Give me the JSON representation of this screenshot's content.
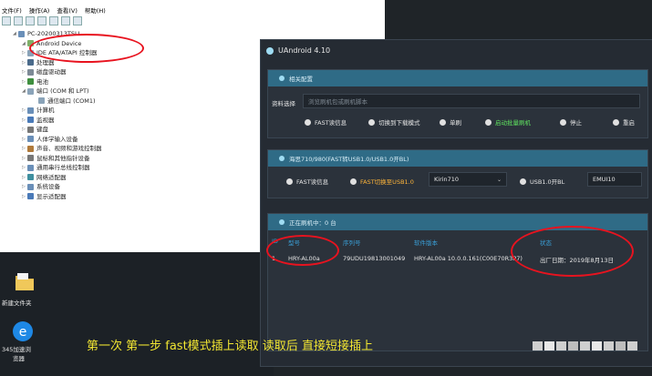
{
  "menu": [
    "文件(F)",
    "操作(A)",
    "查看(V)",
    "帮助(H)"
  ],
  "tree": [
    {
      "label": "PC-20200313TSLL",
      "expander": "◢",
      "indent": 0,
      "icon": "#6a8fb8"
    },
    {
      "label": "Android Device",
      "expander": "◢",
      "indent": 10,
      "icon": "#7fb069"
    },
    {
      "label": "IDE ATA/ATAPI 控制器",
      "expander": "▷",
      "indent": 10,
      "icon": "#8aa3b8"
    },
    {
      "label": "处理器",
      "expander": "▷",
      "indent": 10,
      "icon": "#4a6a8a"
    },
    {
      "label": "磁盘驱动器",
      "expander": "▷",
      "indent": 10,
      "icon": "#7d8a96"
    },
    {
      "label": "电池",
      "expander": "▷",
      "indent": 10,
      "icon": "#3f8f3f"
    },
    {
      "label": "端口 (COM 和 LPT)",
      "expander": "◢",
      "indent": 10,
      "icon": "#8aa3b8"
    },
    {
      "label": "通信端口 (COM1)",
      "expander": "",
      "indent": 22,
      "icon": "#8aa3b8"
    },
    {
      "label": "计算机",
      "expander": "▷",
      "indent": 10,
      "icon": "#6a8fb8"
    },
    {
      "label": "监视器",
      "expander": "▷",
      "indent": 10,
      "icon": "#4a7ab8"
    },
    {
      "label": "键盘",
      "expander": "▷",
      "indent": 10,
      "icon": "#777"
    },
    {
      "label": "人体学输入设备",
      "expander": "▷",
      "indent": 10,
      "icon": "#6a8fb8"
    },
    {
      "label": "声音、视频和游戏控制器",
      "expander": "▷",
      "indent": 10,
      "icon": "#b07a3a"
    },
    {
      "label": "鼠标和其他指针设备",
      "expander": "▷",
      "indent": 10,
      "icon": "#777"
    },
    {
      "label": "通用串行总线控制器",
      "expander": "▷",
      "indent": 10,
      "icon": "#6a8fb8"
    },
    {
      "label": "网络适配器",
      "expander": "▷",
      "indent": 10,
      "icon": "#3f8f9f"
    },
    {
      "label": "系统设备",
      "expander": "▷",
      "indent": 10,
      "icon": "#6a8fb8"
    },
    {
      "label": "显示适配器",
      "expander": "▷",
      "indent": 10,
      "icon": "#4a7ab8"
    }
  ],
  "desktop": {
    "folder_label": "新建文件夹",
    "browser_label": "345加速浏",
    "browser_label2": "览器"
  },
  "ua": {
    "title": "UAndroid 4.10",
    "panel1": {
      "head": "相关配置",
      "file_label": "资料选择",
      "file_placeholder": "浏览刷机包或刷机脚本",
      "buttons": [
        "FAST读信息",
        "切换到下载模式",
        "单刷",
        "启动批量刷机",
        "停止",
        "重启"
      ]
    },
    "panel2": {
      "head": "海思710/980(FAST转USB1.0/USB1.0开BL)",
      "fast_info": "FAST读信息",
      "fast_to_usb": "FAST切换至USB1.0",
      "chip": "Kirin710",
      "usb_bl": "USB1.0开BL",
      "emui": "EMUI10"
    },
    "panel3": {
      "head": "正在刷机中：0 台",
      "columns": [
        "ID",
        "型号",
        "序列号",
        "软件版本",
        "状态"
      ],
      "row": {
        "id": "1",
        "model": "HRY-AL00a",
        "serial": "79UDU19813001049",
        "version": "HRY-AL00a 10.0.0.161(C00E70R3P7)",
        "status": "出厂日期：2019年8月13日"
      }
    }
  },
  "caption": "第一次 第一步 fast模式插上读取 读取后 直接短接插上",
  "colors": {
    "highlight": "#e8131f",
    "caption": "#f2e632",
    "accent": "#2f6b86"
  }
}
